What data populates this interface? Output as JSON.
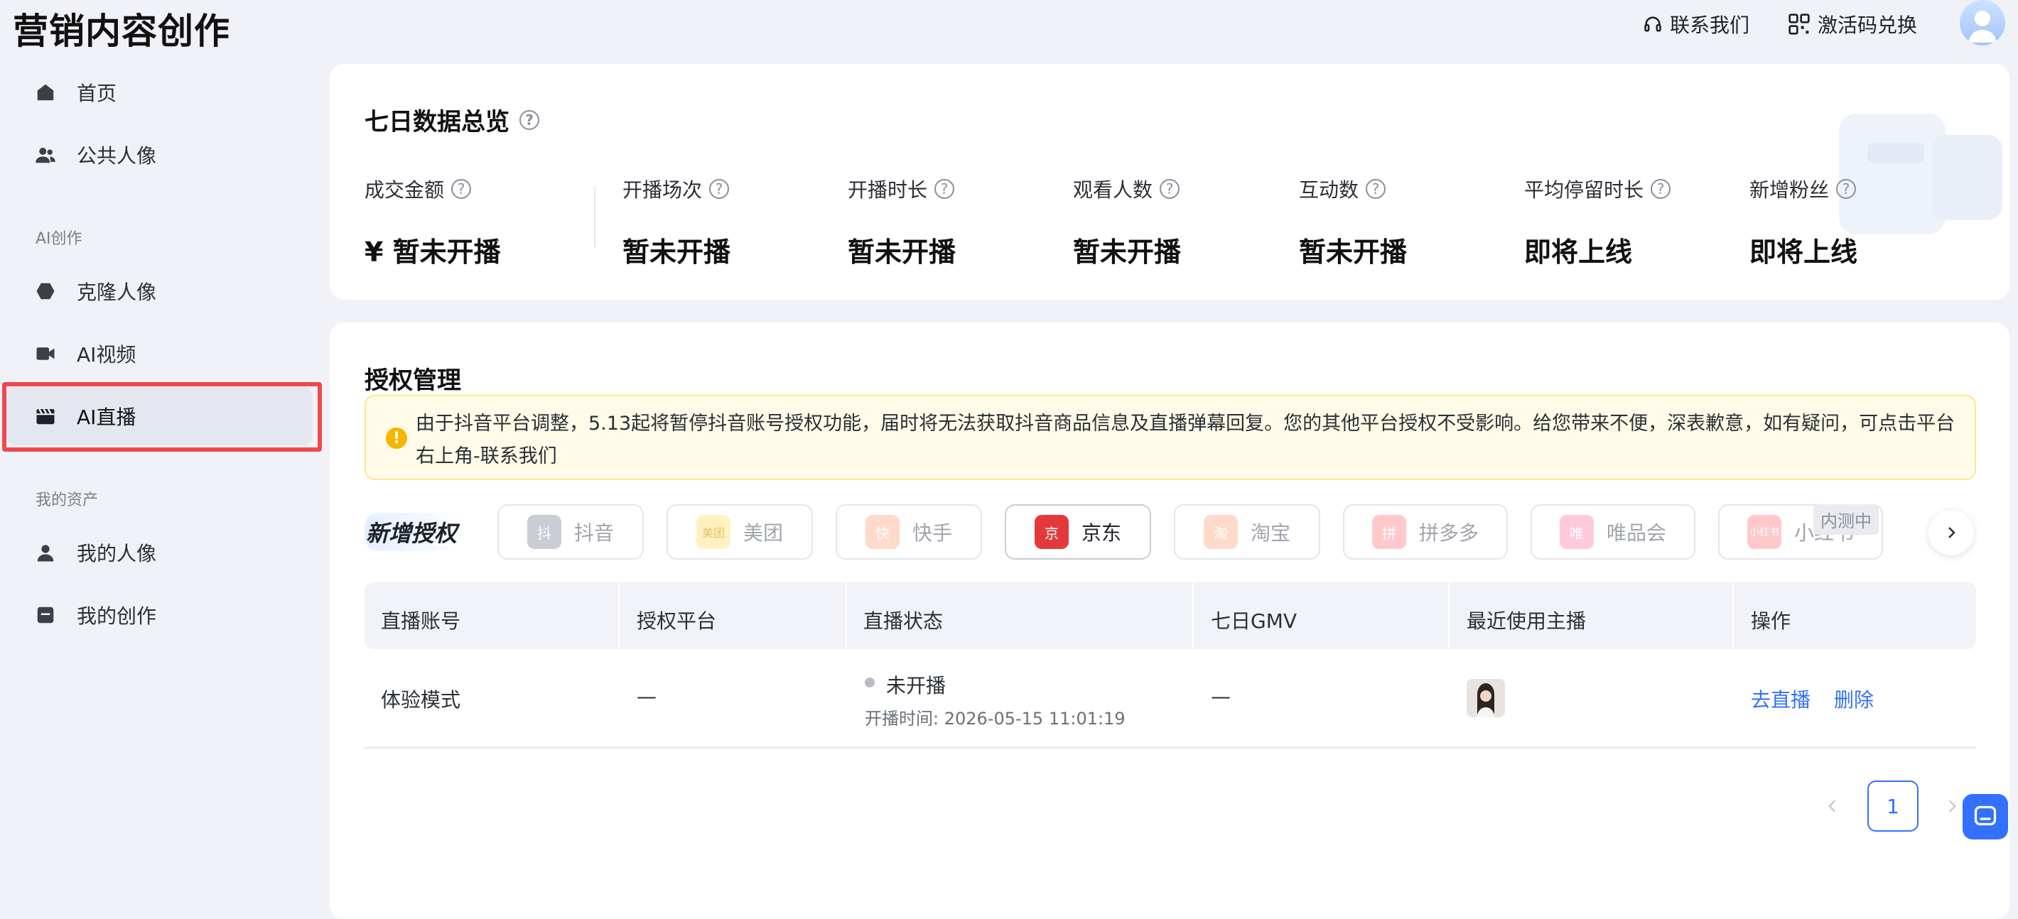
{
  "header": {
    "brand": "营销内容创作",
    "contact": "联系我们",
    "redeem": "激活码兑换"
  },
  "sidebar": {
    "home": "首页",
    "public_avatar": "公共人像",
    "section_ai": "AI创作",
    "clone_avatar": "克隆人像",
    "ai_video": "AI视频",
    "ai_live": "AI直播",
    "section_assets": "我的资产",
    "my_avatar": "我的人像",
    "my_creation": "我的创作"
  },
  "overview": {
    "title": "七日数据总览",
    "stats": [
      {
        "label": "成交金额",
        "value": "¥ 暂未开播"
      },
      {
        "label": "开播场次",
        "value": "暂未开播"
      },
      {
        "label": "开播时长",
        "value": "暂未开播"
      },
      {
        "label": "观看人数",
        "value": "暂未开播"
      },
      {
        "label": "互动数",
        "value": "暂未开播"
      },
      {
        "label": "平均停留时长",
        "value": "即将上线"
      },
      {
        "label": "新增粉丝",
        "value": "即将上线"
      }
    ]
  },
  "auth": {
    "title": "授权管理",
    "notice": "由于抖音平台调整，5.13起将暂停抖音账号授权功能，届时将无法获取抖音商品信息及直播弹幕回复。您的其他平台授权不受影响。给您带来不便，深表歉意，如有疑问，可点击平台右上角-联系我们",
    "add_label": "新增授权",
    "platforms": [
      {
        "name": "抖音",
        "logo": "抖"
      },
      {
        "name": "美团",
        "logo": "美团"
      },
      {
        "name": "快手",
        "logo": "快"
      },
      {
        "name": "京东",
        "logo": "京"
      },
      {
        "name": "淘宝",
        "logo": "淘"
      },
      {
        "name": "拼多多",
        "logo": "拼"
      },
      {
        "name": "唯品会",
        "logo": "唯"
      },
      {
        "name": "小红书",
        "logo": "小红书"
      }
    ],
    "beta_badge": "内测中",
    "table": {
      "headers": [
        "直播账号",
        "授权平台",
        "直播状态",
        "七日GMV",
        "最近使用主播",
        "操作"
      ],
      "rows": [
        {
          "account": "体验模式",
          "platform": "—",
          "status": "未开播",
          "start_time": "开播时间: 2026-05-15 11:01:19",
          "gmv": "—",
          "action_live": "去直播",
          "action_delete": "删除"
        }
      ]
    },
    "pagination": {
      "current": "1"
    }
  },
  "colors": {
    "accent": "#3370ff",
    "highlight": "#f0484e",
    "warning": "#f7b500"
  }
}
